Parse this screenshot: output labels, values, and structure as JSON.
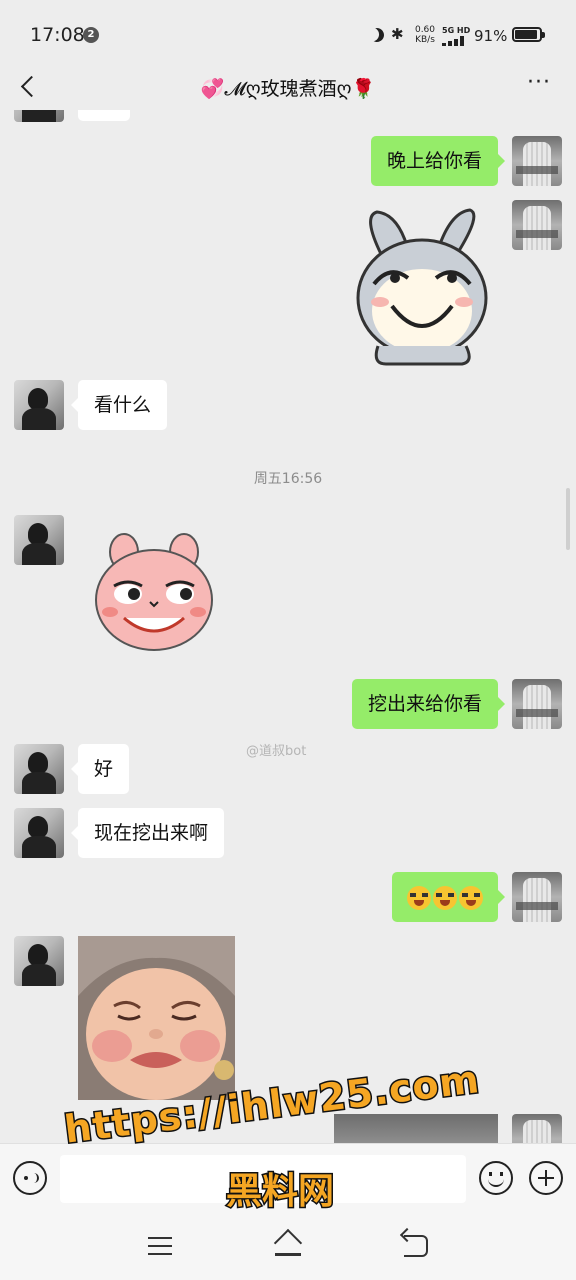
{
  "status_bar": {
    "time": "17:08",
    "notification_badge": "2",
    "net_speed": "0.60 KB/s",
    "net_type": "5G HD",
    "battery_percent": "91%",
    "battery_level": 0.91
  },
  "header": {
    "title": "💞𝓜ღ玫瑰煮酒ღ🌹",
    "icons": {
      "back": "back-icon",
      "more": "more-icon"
    }
  },
  "messages": [
    {
      "from": "me",
      "type": "text",
      "text": "晚上给你看"
    },
    {
      "from": "me",
      "type": "sticker",
      "description": "grinning-bunny-sticker"
    },
    {
      "from": "them",
      "type": "text",
      "text": "看什么"
    },
    {
      "type": "timestamp",
      "text": "周五16:56"
    },
    {
      "from": "them",
      "type": "sticker",
      "description": "pink-bunny-smirk-sticker"
    },
    {
      "from": "me",
      "type": "text",
      "text": "挖出来给你看"
    },
    {
      "from": "them",
      "type": "text",
      "text": "好"
    },
    {
      "from": "them",
      "type": "text",
      "text": "现在挖出来啊"
    },
    {
      "from": "me",
      "type": "emoji",
      "text": "😭😭😭"
    },
    {
      "from": "them",
      "type": "image",
      "description": "crying-baby-photo"
    },
    {
      "from": "me",
      "type": "image",
      "description": "partial-image"
    }
  ],
  "watermark": "@道叔bot",
  "overlay": {
    "url": "https://ihlw25.com",
    "label": "黑料网"
  },
  "input_bar": {
    "icons": {
      "voice": "voice-icon",
      "emoji": "emoji-icon",
      "plus": "plus-icon"
    }
  },
  "nav_bar": {
    "icons": {
      "menu": "menu-icon",
      "home": "home-icon",
      "back": "nav-back-icon"
    }
  }
}
